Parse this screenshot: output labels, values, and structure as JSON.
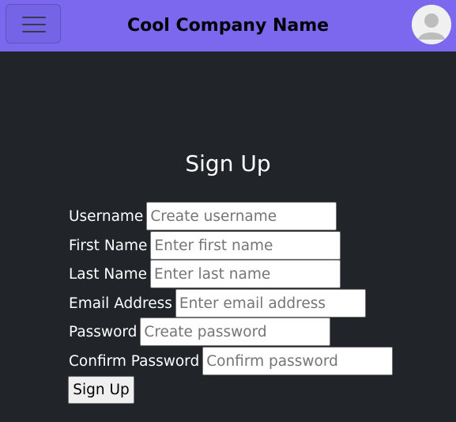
{
  "navbar": {
    "menu_icon": "hamburger-menu-icon",
    "brand": "Cool Company Name",
    "avatar_icon": "user-avatar-icon",
    "background": "#7b68ee"
  },
  "form": {
    "title": "Sign Up",
    "fields": [
      {
        "label": "Username",
        "placeholder": "Create username",
        "value": ""
      },
      {
        "label": "First Name",
        "placeholder": "Enter first name",
        "value": ""
      },
      {
        "label": "Last Name",
        "placeholder": "Enter last name",
        "value": ""
      },
      {
        "label": "Email Address",
        "placeholder": "Enter email address",
        "value": ""
      },
      {
        "label": "Password",
        "placeholder": "Create password",
        "value": ""
      },
      {
        "label": "Confirm Password",
        "placeholder": "Confirm password",
        "value": ""
      }
    ],
    "submit_label": "Sign Up"
  },
  "colors": {
    "page_background": "#212529",
    "text": "#ffffff"
  }
}
